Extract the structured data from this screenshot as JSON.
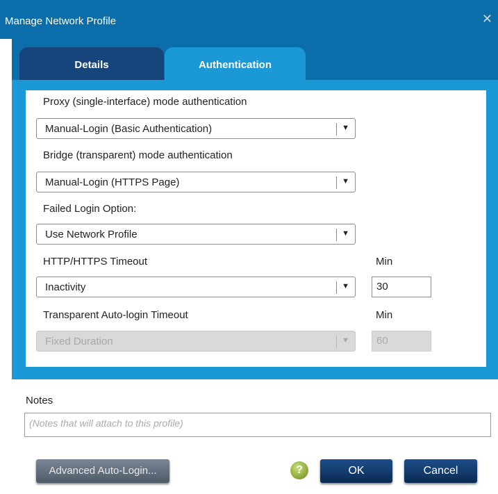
{
  "window": {
    "title": "Manage Network Profile",
    "close_glyph": "✕"
  },
  "tabs": [
    {
      "label": "Details",
      "active": false
    },
    {
      "label": "Authentication",
      "active": true
    }
  ],
  "form": {
    "proxy_label": "Proxy (single-interface) mode authentication",
    "proxy_value": "Manual-Login (Basic Authentication)",
    "bridge_label": "Bridge (transparent) mode authentication",
    "bridge_value": "Manual-Login (HTTPS Page)",
    "failed_label": "Failed Login Option:",
    "failed_value": "Use Network Profile",
    "http_timeout_label": "HTTP/HTTPS Timeout",
    "http_timeout_unit": "Min",
    "http_timeout_type": "Inactivity",
    "http_timeout_value": "30",
    "auto_timeout_label": "Transparent Auto-login Timeout",
    "auto_timeout_unit": "Min",
    "auto_timeout_type": "Fixed Duration",
    "auto_timeout_value": "60"
  },
  "notes": {
    "label": "Notes",
    "placeholder": "(Notes that will attach to this profile)"
  },
  "footer": {
    "advanced_label": "Advanced Auto-Login...",
    "help_glyph": "?",
    "ok_label": "OK",
    "cancel_label": "Cancel"
  },
  "colors": {
    "title_bar": "#0b6eaa",
    "active_tab": "#1a99d6",
    "inactive_tab": "#15457a",
    "button": "#0a2a52"
  },
  "icons": {
    "dropdown": "chevron-down-icon",
    "help": "help-icon",
    "close": "close-icon"
  }
}
